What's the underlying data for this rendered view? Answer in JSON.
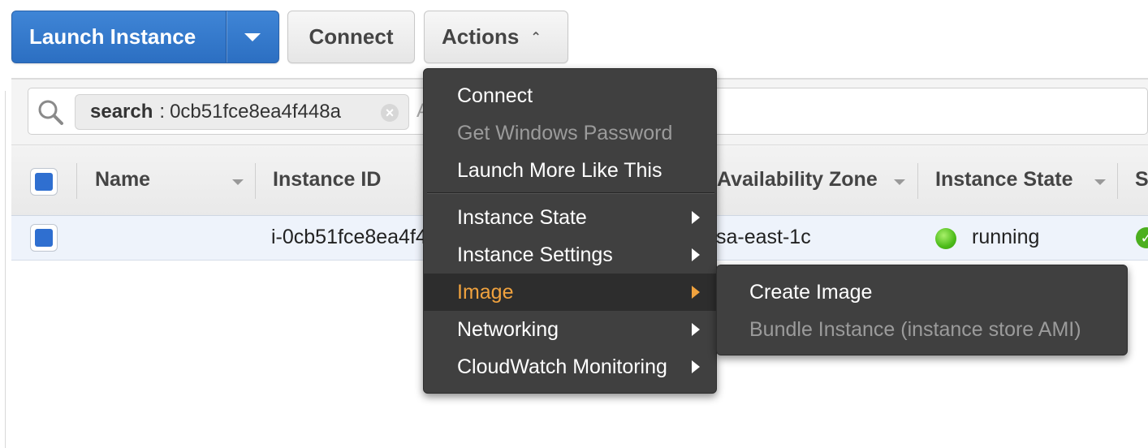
{
  "toolbar": {
    "launch_label": "Launch Instance",
    "connect_label": "Connect",
    "actions_label": "Actions"
  },
  "search": {
    "token_key": "search",
    "token_sep": ":",
    "token_value": "0cb51fce8ea4f448a",
    "more_hint": "A"
  },
  "table": {
    "columns": [
      "Name",
      "Instance ID",
      "Availability Zone",
      "Instance State",
      "S"
    ],
    "rows": [
      {
        "name": "",
        "instance_id": "i-0cb51fce8ea4f4",
        "availability_zone": "sa-east-1c",
        "instance_state": "running"
      }
    ]
  },
  "actions_menu": {
    "items": [
      {
        "label": "Connect",
        "enabled": true
      },
      {
        "label": "Get Windows Password",
        "enabled": false
      },
      {
        "label": "Launch More Like This",
        "enabled": true
      },
      {
        "label": "Instance State",
        "submenu": true
      },
      {
        "label": "Instance Settings",
        "submenu": true
      },
      {
        "label": "Image",
        "submenu": true,
        "active": true
      },
      {
        "label": "Networking",
        "submenu": true
      },
      {
        "label": "CloudWatch Monitoring",
        "submenu": true
      }
    ]
  },
  "image_submenu": {
    "items": [
      {
        "label": "Create Image",
        "enabled": true
      },
      {
        "label": "Bundle Instance (instance store AMI)",
        "enabled": false
      }
    ]
  },
  "colors": {
    "primary": "#2c6fc2",
    "menu_bg": "#404040",
    "menu_active_text": "#f0a23e",
    "running": "#4cbb19"
  }
}
